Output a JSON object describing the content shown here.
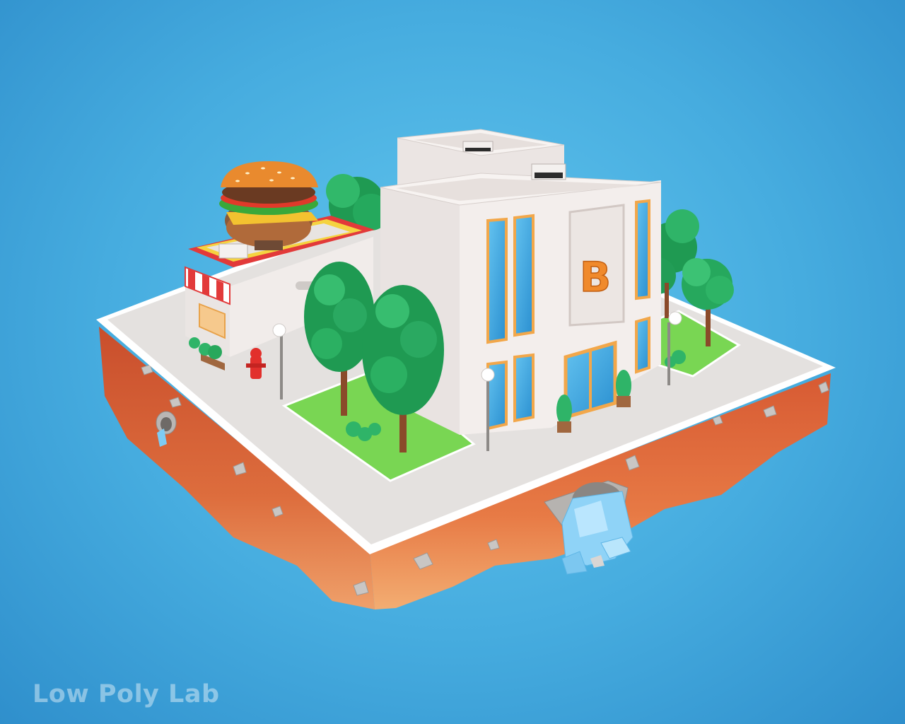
{
  "scene": {
    "building_sign_letter": "B",
    "watermark": "Low Poly Lab"
  },
  "colors": {
    "sky": "#4fb4e4",
    "soil": "#d9663a",
    "soil_light": "#f0a16a",
    "pavement": "#e6e3e1",
    "curb": "#ffffff",
    "grass": "#7ed957",
    "tree": "#23a65a",
    "trunk": "#8a4a2a",
    "building": "#f2ecea",
    "window": "#3aa8e0",
    "trim": "#f2a74a",
    "sign_letter": "#f08a2c",
    "shop_red": "#e23a3a",
    "shop_yellow": "#f5d340",
    "water": "#8fd3f7"
  },
  "icons": {
    "burger": "burger-icon",
    "hydrant": "fire-hydrant-icon",
    "lamp": "street-lamp-icon"
  }
}
